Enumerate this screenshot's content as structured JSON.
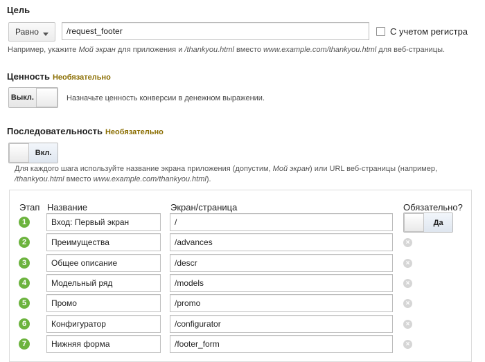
{
  "goal": {
    "title": "Цель",
    "match_type": "Равно",
    "value": "/request_footer",
    "case_sensitive_label": "С учетом регистра",
    "hint": {
      "p1": "Например, укажите ",
      "e1": "Мой экран",
      "p2": " для приложения и ",
      "e2": "/thankyou.html",
      "p3": " вместо ",
      "e3": "www.example.com/thankyou.html",
      "p4": " для веб-страницы."
    }
  },
  "value_section": {
    "title": "Ценность",
    "optional": "Необязательно",
    "toggle_label": "Выкл.",
    "toggle_on": false,
    "description": "Назначьте ценность конверсии в денежном выражении."
  },
  "funnel": {
    "title": "Последовательность",
    "optional": "Необязательно",
    "toggle_label": "Вкл.",
    "toggle_on": true,
    "hint": {
      "p1": "Для каждого шага используйте название экрана приложения (допустим, ",
      "e1": "Мой экран",
      "p2": ") или URL веб-страницы (например,",
      "e2": "/thankyou.html",
      "p3": " вместо ",
      "e3": "www.example.com/thankyou.html",
      "p4": ")."
    },
    "columns": {
      "step": "Этап",
      "name": "Название",
      "screen": "Экран/страница",
      "required": "Обязательно?"
    },
    "required_toggle_label": "Да",
    "steps": [
      {
        "num": "1",
        "name": "Вход: Первый экран",
        "screen": "/"
      },
      {
        "num": "2",
        "name": "Преимущества",
        "screen": "/advances"
      },
      {
        "num": "3",
        "name": "Общее описание",
        "screen": "/descr"
      },
      {
        "num": "4",
        "name": "Модельный ряд",
        "screen": "/models"
      },
      {
        "num": "5",
        "name": "Промо",
        "screen": "/promo"
      },
      {
        "num": "6",
        "name": "Конфигуратор",
        "screen": "/configurator"
      },
      {
        "num": "7",
        "name": "Нижняя форма",
        "screen": "/footer_form"
      }
    ],
    "remove_icon": "×"
  },
  "colors": {
    "step_badge": "#6cb33e",
    "optional_text": "#8a6d00"
  }
}
